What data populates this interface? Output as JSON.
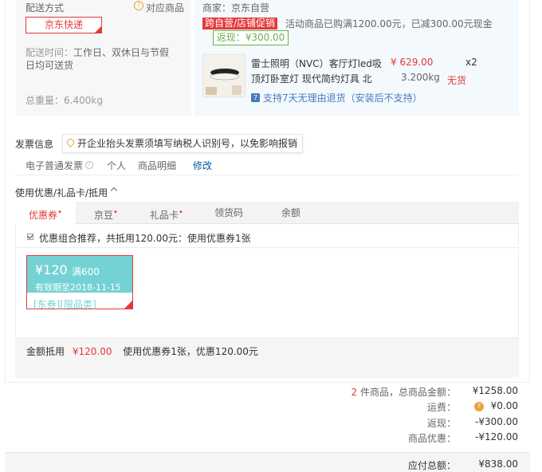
{
  "shipping": {
    "label": "配送方式",
    "match_icon": "warning-icon",
    "match_label": "对应商品",
    "method": "京东快递",
    "delivery_label": "配送时间：",
    "delivery_value": "工作日、双休日与节假日均可送货",
    "weight_label": "总重量：",
    "weight_value": "6.400kg"
  },
  "order": {
    "seller": "商家：京东自营",
    "promo_tag": "跨自营/店铺促销",
    "promo_text": "活动商品已购满1200.00元，已减300.00元现金",
    "rebate": "返现：¥300.00",
    "product": {
      "name": "雷士照明（NVC）客厅灯led吸顶灯卧室灯 现代简约灯具 北",
      "price": "¥ 629.00",
      "qty": "x2",
      "weight": "3.200kg",
      "stock": "无货"
    },
    "return_policy": "支持7天无理由退货（安装后不支持）"
  },
  "invoice": {
    "title": "发票信息",
    "tip": "开企业抬头发票须填写纳税人识别号，以免影响报销",
    "type": "电子普通发票",
    "person": "个人",
    "detail": "商品明细",
    "modify": "修改"
  },
  "coupons": {
    "title": "使用优惠/礼品卡/抵用",
    "tabs": [
      {
        "label": "优惠券",
        "dot": "•"
      },
      {
        "label": "京豆",
        "dot": "•"
      },
      {
        "label": "礼品卡",
        "dot": "•"
      },
      {
        "label": "领货码",
        "dot": ""
      },
      {
        "label": "余额",
        "dot": ""
      }
    ],
    "combo_text": "优惠组合推荐，共抵用120.00元：使用优惠券1张",
    "card": {
      "amount": "¥120",
      "condition": "满600",
      "valid": "有效期至2018-11-15",
      "tags": "[东券][限品类]"
    },
    "summary_label": "金额抵用",
    "summary_amount": "¥120.00",
    "summary_text": "使用优惠券1张，优惠120.00元"
  },
  "totals": {
    "items_count": "2",
    "items_label": "件商品，总商品金额：",
    "items_value": "¥1258.00",
    "fee_label": "运费：",
    "fee_value": "¥0.00",
    "rebate_label": "返现：",
    "rebate_value": "-¥300.00",
    "discount_label": "商品优惠：",
    "discount_value": "-¥120.00",
    "pay_label": "应付总额：",
    "pay_value": "¥838.00"
  }
}
